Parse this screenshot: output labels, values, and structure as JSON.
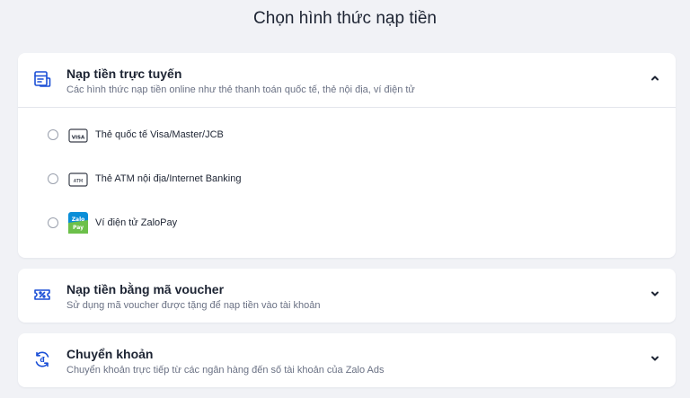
{
  "page": {
    "title": "Chọn hình thức nạp tiền"
  },
  "sections": {
    "online": {
      "title": "Nạp tiền trực tuyến",
      "subtitle": "Các hình thức nạp tiền online như thẻ thanh toán quốc tế, thẻ nội địa, ví điện tử",
      "icon": "online-payment-icon",
      "expanded": true,
      "options": [
        {
          "label": "Thẻ quốc tế Visa/Master/JCB",
          "icon": "visa-card-icon",
          "icon_text": "VISA",
          "selected": false
        },
        {
          "label": "Thẻ ATM nội địa/Internet Banking",
          "icon": "atm-card-icon",
          "icon_text": "ATM",
          "selected": false
        },
        {
          "label": "Ví điện tử ZaloPay",
          "icon": "zalopay-icon",
          "icon_text": "Zalo Pay",
          "selected": false
        }
      ]
    },
    "voucher": {
      "title": "Nạp tiền bằng mã voucher",
      "subtitle": "Sử dụng mã voucher được tặng để nạp tiền vào tài khoản",
      "icon": "voucher-icon",
      "expanded": false
    },
    "transfer": {
      "title": "Chuyển khoản",
      "subtitle": "Chuyển khoản trực tiếp từ các ngân hàng đến số tài khoản của Zalo Ads",
      "icon": "bank-transfer-icon",
      "expanded": false
    }
  },
  "colors": {
    "background": "#f1f2f6",
    "card": "#ffffff",
    "accent": "#1b4fd6",
    "zalopay_green": "#6cc04a",
    "zalopay_blue": "#0a8ed8"
  }
}
